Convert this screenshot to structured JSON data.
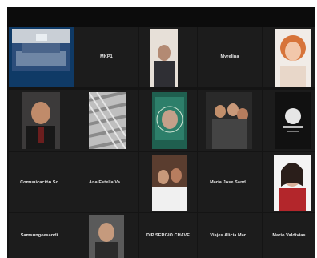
{
  "meeting": {
    "tiles": [
      {
        "id": "t-0-0",
        "label": "",
        "type": "video"
      },
      {
        "id": "t-0-1",
        "label": "MKP1",
        "type": "name"
      },
      {
        "id": "t-0-2",
        "label": "",
        "type": "video"
      },
      {
        "id": "t-0-3",
        "label": "Myrelina",
        "type": "name"
      },
      {
        "id": "t-0-4",
        "label": "",
        "type": "video"
      },
      {
        "id": "t-1-0",
        "label": "",
        "type": "video"
      },
      {
        "id": "t-1-1",
        "label": "",
        "type": "video"
      },
      {
        "id": "t-1-2",
        "label": "",
        "type": "video"
      },
      {
        "id": "t-1-3",
        "label": "",
        "type": "video"
      },
      {
        "id": "t-1-4",
        "label": "",
        "type": "video"
      },
      {
        "id": "t-2-0",
        "label": "Comunicación So...",
        "type": "name"
      },
      {
        "id": "t-2-1",
        "label": "Ana Estella Va...",
        "type": "name"
      },
      {
        "id": "t-2-2",
        "label": "",
        "type": "video"
      },
      {
        "id": "t-2-3",
        "label": "María Jose Sand...",
        "type": "name"
      },
      {
        "id": "t-2-4",
        "label": "",
        "type": "video"
      },
      {
        "id": "t-3-0",
        "label": "Samsungeesandi...",
        "type": "name"
      },
      {
        "id": "t-3-1",
        "label": "",
        "type": "video"
      },
      {
        "id": "t-3-2",
        "label": "DIP SERGIO CHAVE",
        "type": "name"
      },
      {
        "id": "t-3-3",
        "label": "Viajes Alicia Mar...",
        "type": "name"
      },
      {
        "id": "t-3-4",
        "label": "Mario Valdivias",
        "type": "name"
      }
    ]
  }
}
